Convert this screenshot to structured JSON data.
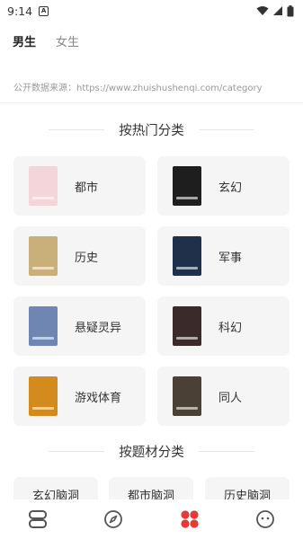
{
  "status_bar": {
    "time": "9:14",
    "notification_letter": "A"
  },
  "tabs": [
    {
      "label": "男生",
      "active": true
    },
    {
      "label": "女生",
      "active": false
    }
  ],
  "source_notice": "公开数据来源：https://www.zhuishushenqi.com/category",
  "hot_section": {
    "title": "按热门分类"
  },
  "categories": [
    {
      "label": "都市",
      "cover_color": "#f4d6da"
    },
    {
      "label": "玄幻",
      "cover_color": "#1e1e1e"
    },
    {
      "label": "历史",
      "cover_color": "#c9b07a"
    },
    {
      "label": "军事",
      "cover_color": "#21304a"
    },
    {
      "label": "悬疑灵异",
      "cover_color": "#6f86b2"
    },
    {
      "label": "科幻",
      "cover_color": "#3b2a2a"
    },
    {
      "label": "游戏体育",
      "cover_color": "#d48b1e"
    },
    {
      "label": "同人",
      "cover_color": "#4a4036"
    }
  ],
  "theme_section": {
    "title": "按题材分类"
  },
  "themes": [
    {
      "label": "玄幻脑洞"
    },
    {
      "label": "都市脑洞"
    },
    {
      "label": "历史脑洞"
    }
  ],
  "bottom_nav": [
    {
      "icon": "bookshelf-icon",
      "active": false
    },
    {
      "icon": "compass-icon",
      "active": false
    },
    {
      "icon": "category-icon",
      "active": true
    },
    {
      "icon": "profile-icon",
      "active": false
    }
  ],
  "colors": {
    "accent": "#e53935",
    "card_bg": "#f5f5f5",
    "inactive_icon": "#555555"
  }
}
